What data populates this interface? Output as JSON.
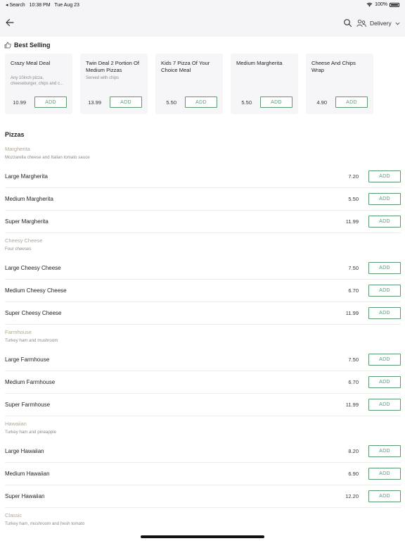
{
  "status_bar": {
    "back_app": "◂ Search",
    "time": "10:38 PM",
    "date": "Tue Aug 23",
    "battery": "100%"
  },
  "nav": {
    "back_icon": "arrow-left-icon",
    "search_icon": "search-icon",
    "mode_icon": "delivery-people-icon",
    "mode_label": "Delivery",
    "mode_chevron": "chevron-down-icon"
  },
  "best_selling": {
    "title": "Best Selling",
    "icon": "thumbs-up-icon",
    "items": [
      {
        "name": "Crazy Meal Deal",
        "desc": "Any 10inch  pizza, cheeseburger, chips and c...",
        "price": "10.99",
        "add": "ADD"
      },
      {
        "name": "Twin Deal 2 Portion Of Medium Pizzas",
        "desc": "Served with chips",
        "price": "13.99",
        "add": "ADD"
      },
      {
        "name": "Kids 7 Pizza Of Your Choice Meal",
        "desc": "",
        "price": "5.50",
        "add": "ADD"
      },
      {
        "name": "Medium Margherita",
        "desc": "",
        "price": "5.50",
        "add": "ADD"
      },
      {
        "name": "Cheese And Chips Wrap",
        "desc": "",
        "price": "4.90",
        "add": "ADD"
      }
    ]
  },
  "category": {
    "title": "Pizzas",
    "groups": [
      {
        "name": "Margherita",
        "desc": "Mozzarella cheese and Italian tomato sauce",
        "items": [
          {
            "name": "Large Margherita",
            "price": "7.20",
            "add": "ADD"
          },
          {
            "name": "Medium Margherita",
            "price": "5.50",
            "add": "ADD"
          },
          {
            "name": "Super Margherita",
            "price": "11.99",
            "add": "ADD"
          }
        ]
      },
      {
        "name": "Cheesy Cheese",
        "desc": "Four cheeses",
        "items": [
          {
            "name": "Large Cheesy Cheese",
            "price": "7.50",
            "add": "ADD"
          },
          {
            "name": "Medium Cheesy Cheese",
            "price": "6.70",
            "add": "ADD"
          },
          {
            "name": "Super Cheesy Cheese",
            "price": "11.99",
            "add": "ADD"
          }
        ]
      },
      {
        "name": "Farmhouse",
        "desc": "Turkey ham and mushroom",
        "items": [
          {
            "name": "Large Farmhouse",
            "price": "7.50",
            "add": "ADD"
          },
          {
            "name": "Medium Farmhouse",
            "price": "6.70",
            "add": "ADD"
          },
          {
            "name": "Super Farmhouse",
            "price": "11.99",
            "add": "ADD"
          }
        ]
      },
      {
        "name": "Hawaiian",
        "desc": "Turkey ham and pineapple",
        "items": [
          {
            "name": "Large Hawaiian",
            "price": "8.20",
            "add": "ADD"
          },
          {
            "name": "Medium Hawaiian",
            "price": "6.90",
            "add": "ADD"
          },
          {
            "name": "Super Hawaiian",
            "price": "12.20",
            "add": "ADD"
          }
        ]
      },
      {
        "name": "Classic",
        "desc": "Turkey ham, mushroom and fresh tomato",
        "items": []
      }
    ]
  },
  "colors": {
    "accent": "#5b9a71",
    "group_name": "#b1a891",
    "header_bg": "#f5f4f7",
    "card_bg": "#f6f6f8"
  }
}
